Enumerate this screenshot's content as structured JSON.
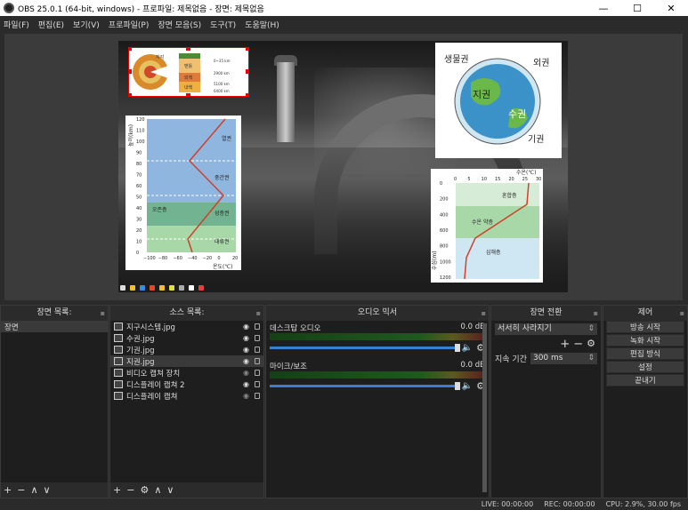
{
  "window": {
    "title": "OBS 25.0.1 (64-bit, windows) - 프로파일: 제목없음 - 장면: 제목없음",
    "minimize": "—",
    "maximize": "☐",
    "close": "✕"
  },
  "menu": [
    "파일(F)",
    "편집(E)",
    "보기(V)",
    "프로파일(P)",
    "장면 모음(S)",
    "도구(T)",
    "도움말(H)"
  ],
  "overlays": {
    "earth_layers": {
      "l1": "지각",
      "l2": "맨틀",
      "l3": "외핵",
      "l4": "내핵"
    },
    "spheres": {
      "bio": "생물권",
      "outer": "외권",
      "geo": "지권",
      "hydro": "수권",
      "atmo": "기권"
    },
    "atmosphere": {
      "ylabel": "높이(km)",
      "xlabel": "온도(℃)",
      "yticks": [
        "120",
        "110",
        "100",
        "90",
        "80",
        "70",
        "60",
        "50",
        "40",
        "30",
        "20",
        "10",
        "0"
      ],
      "xticks": [
        "−100",
        "−80",
        "−60",
        "−40",
        "−20",
        "0",
        "20"
      ],
      "layers": [
        "열권",
        "중간권",
        "성층권",
        "대류권"
      ],
      "ozone": "오존층"
    },
    "ocean": {
      "xlabel": "수온(℃)",
      "ylabel": "수심(m)",
      "xticks": [
        "0",
        "5",
        "10",
        "15",
        "20",
        "25",
        "30"
      ],
      "yticks": [
        "0",
        "200",
        "400",
        "600",
        "800",
        "1000",
        "1200"
      ],
      "layers": [
        "혼합층",
        "수온 약층",
        "심해층"
      ]
    }
  },
  "docks": {
    "scenes": {
      "title": "장면 목록:",
      "items": [
        "장면"
      ],
      "footer": [
        "+",
        "−",
        "∧",
        "∨"
      ]
    },
    "sources": {
      "title": "소스 목록:",
      "items": [
        "지구시스템.jpg",
        "수권.jpg",
        "기권.jpg",
        "지권.jpg",
        "비디오 캡쳐 장치",
        "디스플레이 캡쳐 2",
        "디스플레이 캡쳐"
      ],
      "footer": [
        "+",
        "−",
        "⚙",
        "∧",
        "∨"
      ]
    },
    "mixer": {
      "title": "오디오 믹서",
      "channels": [
        {
          "name": "데스크탑 오디오",
          "level": "0.0 dB"
        },
        {
          "name": "마이크/보조",
          "level": "0.0 dB"
        }
      ]
    },
    "transitions": {
      "title": "장면 전환",
      "selected": "서서히 사라지기",
      "duration_label": "지속 기간",
      "duration": "300 ms"
    },
    "controls": {
      "title": "제어",
      "buttons": [
        "방송 시작",
        "녹화 시작",
        "편집 방식",
        "설정",
        "끝내기"
      ]
    }
  },
  "status": {
    "live": "LIVE: 00:00:00",
    "rec": "REC: 00:00:00",
    "cpu": "CPU: 2.9%, 30.00 fps"
  }
}
